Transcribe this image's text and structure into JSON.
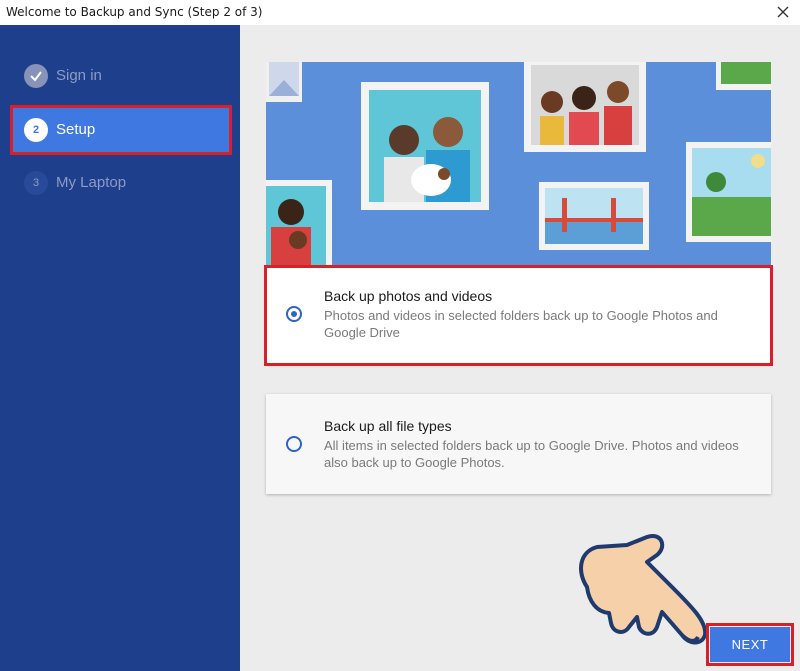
{
  "window": {
    "title": "Welcome to Backup and Sync (Step 2 of 3)"
  },
  "sidebar": {
    "steps": [
      {
        "number": "✓",
        "label": "Sign in",
        "state": "done"
      },
      {
        "number": "2",
        "label": "Setup",
        "state": "active"
      },
      {
        "number": "3",
        "label": "My Laptop",
        "state": "todo"
      }
    ]
  },
  "options": [
    {
      "title": "Back up photos and videos",
      "description": "Photos and videos in selected folders back up to Google Photos and Google Drive",
      "selected": true
    },
    {
      "title": "Back up all file types",
      "description": "All items in selected folders back up to Google Drive. Photos and videos also back up to Google Photos.",
      "selected": false
    }
  ],
  "footer": {
    "next_label": "NEXT"
  },
  "colors": {
    "sidebar": "#1e3f8c",
    "accent": "#3f78e0",
    "highlight": "#d81f2a"
  }
}
